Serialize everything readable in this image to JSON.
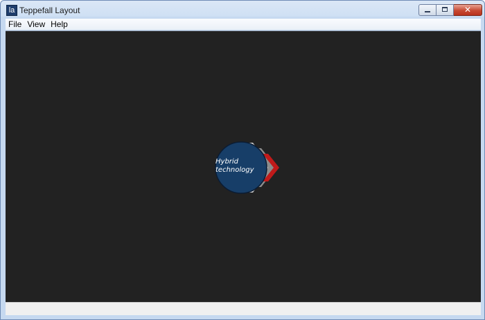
{
  "window": {
    "title": "Teppefall Layout",
    "app_icon_text": "la",
    "close_glyph": "✕"
  },
  "menu": {
    "items": [
      "File",
      "View",
      "Help"
    ]
  },
  "logo": {
    "line1": "Hybrid",
    "line2": "technology",
    "colors": {
      "circle": "#173e68",
      "chevron_outer": "#d2d2d2",
      "chevron_accent": "#c01a1a"
    }
  },
  "colors": {
    "canvas": "#222222",
    "statusbar": "#f0f0f0"
  }
}
